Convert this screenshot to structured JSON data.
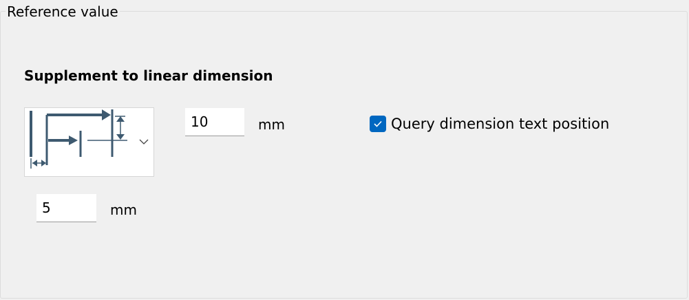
{
  "group": {
    "title": "Reference value"
  },
  "section": {
    "heading": "Supplement to linear dimension"
  },
  "dimension_style_dropdown": {
    "icon": "linear-dimension-reference-icon",
    "expand_icon": "chevron-down-icon"
  },
  "offset_field": {
    "value": "10",
    "unit": "mm"
  },
  "spacing_field": {
    "value": "5",
    "unit": "mm"
  },
  "query_text_position": {
    "label": "Query dimension text position",
    "checked": true
  },
  "colors": {
    "accent": "#0067c0",
    "icon_stroke": "#3e5a70",
    "background": "#f0f0f0"
  }
}
